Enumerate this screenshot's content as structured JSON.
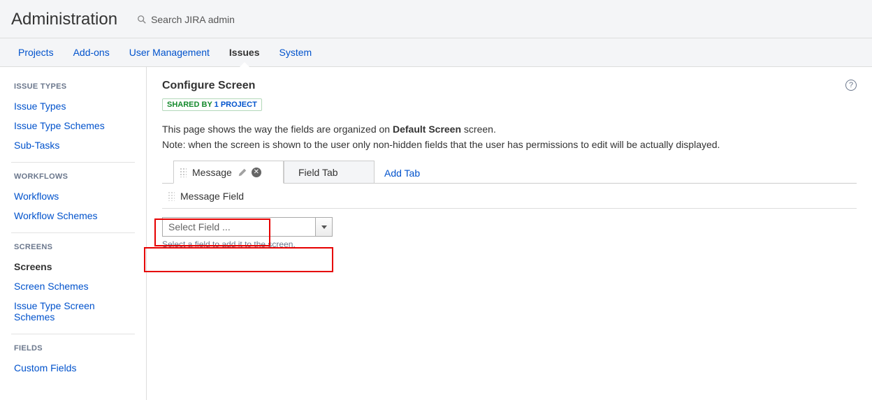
{
  "header": {
    "title": "Administration",
    "search_placeholder": "Search JIRA admin"
  },
  "top_nav": {
    "items": [
      {
        "label": "Projects",
        "active": false
      },
      {
        "label": "Add-ons",
        "active": false
      },
      {
        "label": "User Management",
        "active": false
      },
      {
        "label": "Issues",
        "active": true
      },
      {
        "label": "System",
        "active": false
      }
    ]
  },
  "sidebar": {
    "groups": [
      {
        "heading": "ISSUE TYPES",
        "items": [
          {
            "label": "Issue Types",
            "active": false
          },
          {
            "label": "Issue Type Schemes",
            "active": false
          },
          {
            "label": "Sub-Tasks",
            "active": false
          }
        ]
      },
      {
        "heading": "WORKFLOWS",
        "items": [
          {
            "label": "Workflows",
            "active": false
          },
          {
            "label": "Workflow Schemes",
            "active": false
          }
        ]
      },
      {
        "heading": "SCREENS",
        "items": [
          {
            "label": "Screens",
            "active": true
          },
          {
            "label": "Screen Schemes",
            "active": false
          },
          {
            "label": "Issue Type Screen Schemes",
            "active": false
          }
        ]
      },
      {
        "heading": "FIELDS",
        "items": [
          {
            "label": "Custom Fields",
            "active": false
          }
        ]
      }
    ]
  },
  "main": {
    "page_title": "Configure Screen",
    "shared_by_prefix": "SHARED BY ",
    "shared_by_link": "1 PROJECT",
    "desc_prefix": "This page shows the way the fields are organized on ",
    "desc_bold": "Default Screen",
    "desc_suffix": " screen.",
    "note": "Note: when the screen is shown to the user only non-hidden fields that the user has permissions to edit will be actually displayed.",
    "tabs": [
      {
        "label": "Message",
        "active": true,
        "editable": true
      },
      {
        "label": "Field Tab",
        "active": false,
        "editable": false
      }
    ],
    "add_tab_label": "Add Tab",
    "fields": [
      {
        "label": "Message Field"
      }
    ],
    "select_placeholder": "Select Field ...",
    "select_hint": "Select a field to add it to the screen."
  }
}
